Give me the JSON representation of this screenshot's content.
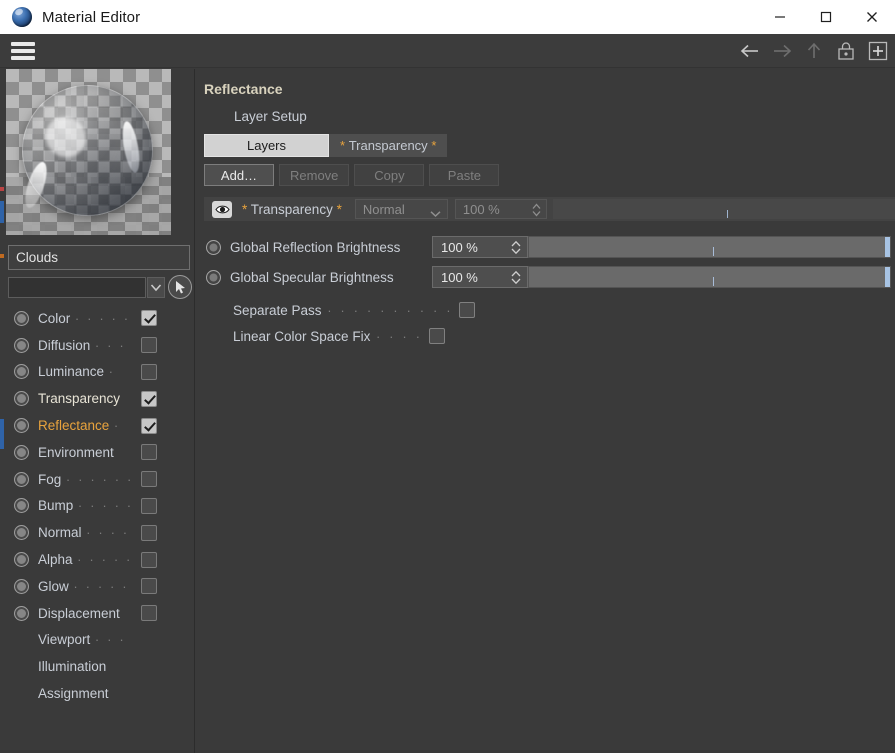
{
  "window": {
    "title": "Material Editor",
    "icon": "material-sphere-icon",
    "minimize_label": "–",
    "maximize_label": "□",
    "close_label": "✕"
  },
  "toolbar": {
    "menu_icon": "hamburger-menu-icon",
    "icons": [
      {
        "name": "back-arrow-icon",
        "enabled": true
      },
      {
        "name": "forward-arrow-icon",
        "enabled": false
      },
      {
        "name": "up-arrow-icon",
        "enabled": false
      },
      {
        "name": "lock-icon",
        "enabled": true
      },
      {
        "name": "add-icon",
        "enabled": true
      }
    ]
  },
  "sidebar": {
    "preview_name": "material-preview-sphere",
    "material_name": "Clouds",
    "search_value": "",
    "dropdown_icon": "chevron-down-icon",
    "picker_icon": "cursor-picker-icon",
    "channels": [
      {
        "label": "Color",
        "dots": ". . . . .",
        "radio": true,
        "checked": true,
        "state": "normal"
      },
      {
        "label": "Diffusion",
        "dots": ". . .",
        "radio": true,
        "checked": false,
        "state": "normal"
      },
      {
        "label": "Luminance",
        "dots": ".",
        "radio": true,
        "checked": false,
        "state": "normal"
      },
      {
        "label": "Transparency",
        "dots": "",
        "radio": true,
        "checked": true,
        "state": "lit"
      },
      {
        "label": "Reflectance",
        "dots": ".",
        "radio": true,
        "checked": true,
        "state": "active"
      },
      {
        "label": "Environment",
        "dots": "",
        "radio": true,
        "checked": false,
        "state": "normal"
      },
      {
        "label": "Fog",
        "dots": ". . . . . .",
        "radio": true,
        "checked": false,
        "state": "normal"
      },
      {
        "label": "Bump",
        "dots": ". . . . .",
        "radio": true,
        "checked": false,
        "state": "normal"
      },
      {
        "label": "Normal",
        "dots": ". . . .",
        "radio": true,
        "checked": false,
        "state": "normal"
      },
      {
        "label": "Alpha",
        "dots": ". . . . .",
        "radio": true,
        "checked": false,
        "state": "normal"
      },
      {
        "label": "Glow",
        "dots": ". . . . .",
        "radio": true,
        "checked": false,
        "state": "normal"
      },
      {
        "label": "Displacement",
        "dots": "",
        "radio": true,
        "checked": false,
        "state": "normal"
      },
      {
        "label": "Viewport",
        "dots": ". . .",
        "radio": false,
        "checked": null,
        "state": "normal"
      },
      {
        "label": "Illumination",
        "dots": "",
        "radio": false,
        "checked": null,
        "state": "normal"
      },
      {
        "label": "Assignment",
        "dots": "",
        "radio": false,
        "checked": null,
        "state": "normal"
      }
    ]
  },
  "main": {
    "section_title": "Reflectance",
    "sub_title": "Layer Setup",
    "tabs": [
      {
        "label": "Layers",
        "active": true
      },
      {
        "label": "* Transparency *",
        "active": false
      }
    ],
    "buttons": [
      {
        "label": "Add…",
        "enabled": true
      },
      {
        "label": "Remove",
        "enabled": false
      },
      {
        "label": "Copy",
        "enabled": false
      },
      {
        "label": "Paste",
        "enabled": false
      }
    ],
    "layer": {
      "visibility_icon": "eye-icon",
      "name": "* Transparency *",
      "blend_mode": "Normal",
      "opacity": "100 %"
    },
    "properties": [
      {
        "label": "Global Reflection Brightness",
        "value": "100 %"
      },
      {
        "label": "Global Specular Brightness",
        "value": "100 %"
      }
    ],
    "checks": [
      {
        "label": "Separate Pass",
        "dots": ". . . . . . . . . .",
        "checked": false
      },
      {
        "label": "Linear Color Space Fix",
        "dots": ". . . .",
        "checked": false
      }
    ]
  },
  "colors": {
    "accent_orange": "#e8a33d",
    "panel_bg": "#3a3a3a",
    "title_bg": "#ffffff",
    "slider_fill": "#6a6a6a",
    "slider_handle": "#a8c4e4"
  }
}
